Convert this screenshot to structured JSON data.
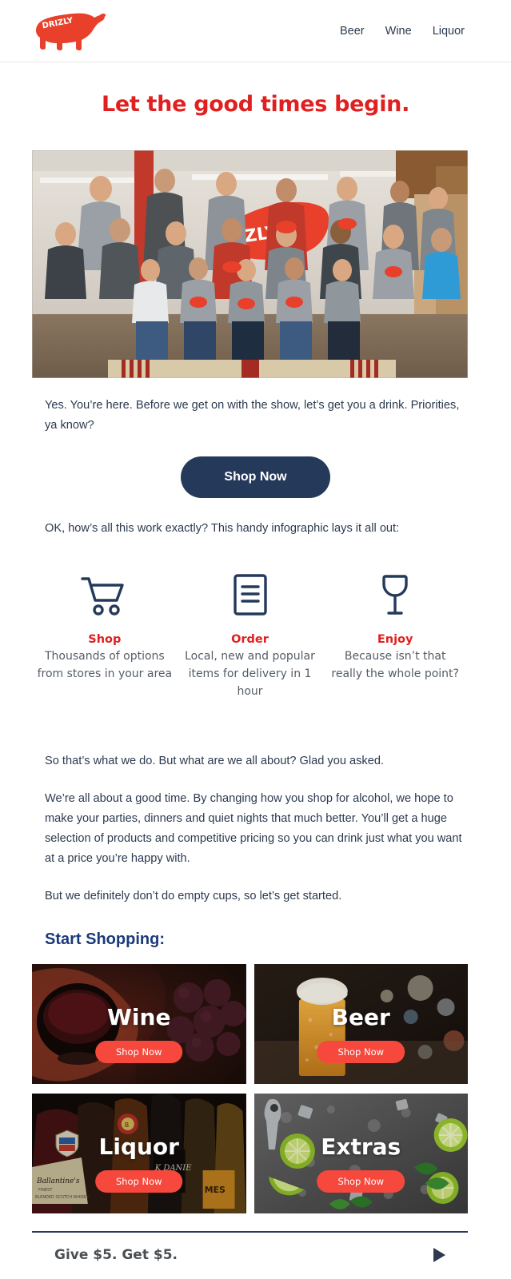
{
  "brand": {
    "name": "DRIZLY",
    "logo_word": "DRIZLY",
    "red": "#e8402a",
    "navy": "#25395a",
    "accent_red": "#e02020",
    "tile_button_red": "#f6483c",
    "heading_blue": "#1b3a7a"
  },
  "nav": {
    "items": [
      {
        "label": "Beer"
      },
      {
        "label": "Wine"
      },
      {
        "label": "Liquor"
      }
    ]
  },
  "headline": "Let the good times begin.",
  "hero": {
    "alt": "Drizly team group photo in office with red Drizly bear banner"
  },
  "intro": {
    "paragraph": "Yes. You’re here. Before we get on with the show, let’s get you a drink. Priorities, ya know?"
  },
  "cta": {
    "label": "Shop Now"
  },
  "how_it_works": {
    "lead": "OK, how’s all this work exactly? This handy infographic lays it all out:",
    "steps": [
      {
        "icon": "shopping-cart-icon",
        "title": "Shop",
        "desc": "Thousands of options from stores in your area"
      },
      {
        "icon": "order-document-icon",
        "title": "Order",
        "desc": "Local, new and popular items for delivery in 1 hour"
      },
      {
        "icon": "wine-glass-icon",
        "title": "Enjoy",
        "desc": "Because isn’t that really the whole point?"
      }
    ]
  },
  "about": {
    "p1": "So that’s what we do. But what are we all about? Glad you asked.",
    "p2": "We’re all about a good time. By changing how you shop for alcohol, we hope to make your parties, dinners and quiet nights that much better. You’ll get a huge selection of products and competitive pricing so you can drink just what you want at a price you’re happy with.",
    "p3": "But we definitely don’t do empty cups, so let’s get started."
  },
  "start_shopping": {
    "heading": "Start Shopping:",
    "tiles": [
      {
        "label": "Wine",
        "button": "Shop Now",
        "image": "red-wine-glass-and-grapes"
      },
      {
        "label": "Beer",
        "button": "Shop Now",
        "image": "beer-glass-with-foam"
      },
      {
        "label": "Liquor",
        "button": "Shop Now",
        "image": "liquor-bottles-whisky"
      },
      {
        "label": "Extras",
        "button": "Shop Now",
        "image": "limes-mint-ice-on-stone"
      }
    ]
  },
  "footer": {
    "text": "Give $5. Get $5.",
    "arrow_icon": "play-arrow-icon"
  }
}
